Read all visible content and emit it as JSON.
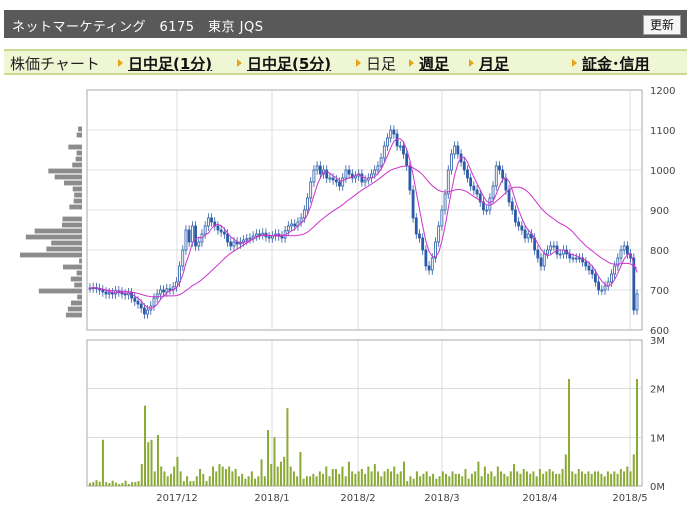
{
  "header": {
    "title": "ネットマーケティング　6175　東京 JQS",
    "refresh_label": "更新"
  },
  "tabs": [
    {
      "label": "株価チャート",
      "link": false,
      "arrow": false
    },
    {
      "label": "日中足(1分)",
      "link": true,
      "arrow": true
    },
    {
      "label": "日中足(5分)",
      "link": true,
      "arrow": true
    },
    {
      "label": "日足",
      "link": false,
      "arrow": true
    },
    {
      "label": "週足",
      "link": true,
      "arrow": true
    },
    {
      "label": "月足",
      "link": true,
      "arrow": true
    },
    {
      "label": "証金･信用",
      "link": true,
      "arrow": true
    }
  ],
  "chart_data": {
    "type": "candlestick",
    "price_axis": {
      "ticks": [
        600,
        700,
        800,
        900,
        1000,
        1100,
        1200
      ],
      "range": [
        600,
        1200
      ]
    },
    "volume_axis": {
      "ticks": [
        "0M",
        "1M",
        "2M",
        "3M"
      ],
      "range": [
        0,
        3000000
      ]
    },
    "x_tick_labels": [
      "2017/12",
      "2018/1",
      "2018/2",
      "2018/3",
      "2018/4",
      "2018/5"
    ],
    "colors": {
      "up": "#2a5aa8",
      "down": "#2a5aa8",
      "ma": "#cc33cc",
      "volume": "#8aaa36",
      "grid": "#c8c8c8",
      "profile": "#8c8c8c"
    },
    "closes": [
      705,
      706,
      704,
      700,
      695,
      690,
      693,
      690,
      698,
      695,
      690,
      688,
      693,
      680,
      672,
      665,
      655,
      640,
      650,
      660,
      680,
      690,
      700,
      695,
      703,
      700,
      708,
      720,
      760,
      800,
      850,
      820,
      860,
      810,
      820,
      840,
      860,
      880,
      870,
      860,
      850,
      845,
      840,
      820,
      810,
      820,
      815,
      820,
      825,
      828,
      830,
      835,
      840,
      838,
      842,
      833,
      830,
      835,
      840,
      835,
      830,
      848,
      860,
      865,
      860,
      870,
      880,
      900,
      930,
      970,
      1000,
      1010,
      990,
      1000,
      980,
      980,
      975,
      970,
      960,
      980,
      1000,
      990,
      980,
      985,
      990,
      970,
      975,
      980,
      990,
      1000,
      1010,
      1030,
      1060,
      1080,
      1100,
      1090,
      1060,
      1060,
      1040,
      1010,
      950,
      880,
      840,
      830,
      800,
      760,
      750,
      780,
      820,
      860,
      900,
      940,
      1000,
      1040,
      1060,
      1040,
      1020,
      1000,
      980,
      960,
      950,
      940,
      920,
      900,
      900,
      930,
      960,
      1010,
      1000,
      980,
      950,
      920,
      900,
      870,
      860,
      850,
      830,
      840,
      830,
      800,
      780,
      760,
      790,
      800,
      810,
      810,
      790,
      790,
      800,
      790,
      780,
      780,
      780,
      780,
      770,
      760,
      750,
      740,
      720,
      700,
      700,
      710,
      720,
      740,
      760,
      780,
      800,
      810,
      790,
      780,
      650,
      690
    ],
    "volume_values": [
      60000,
      80000,
      120000,
      90000,
      950000,
      80000,
      60000,
      110000,
      70000,
      40000,
      60000,
      110000,
      40000,
      80000,
      80000,
      100000,
      450000,
      1650000,
      900000,
      950000,
      300000,
      1050000,
      400000,
      300000,
      200000,
      250000,
      400000,
      600000,
      300000,
      100000,
      200000,
      100000,
      100000,
      200000,
      350000,
      250000,
      100000,
      200000,
      400000,
      300000,
      450000,
      400000,
      350000,
      400000,
      300000,
      350000,
      200000,
      250000,
      150000,
      200000,
      300000,
      150000,
      200000,
      550000,
      200000,
      1150000,
      450000,
      1000000,
      400000,
      500000,
      600000,
      1600000,
      400000,
      300000,
      200000,
      700000,
      150000,
      200000,
      200000,
      250000,
      200000,
      300000,
      250000,
      400000,
      200000,
      350000,
      350000,
      250000,
      400000,
      200000,
      500000,
      300000,
      250000,
      300000,
      350000,
      250000,
      400000,
      300000,
      450000,
      300000,
      200000,
      300000,
      350000,
      300000,
      400000,
      250000,
      300000,
      500000,
      100000,
      200000,
      150000,
      300000,
      200000,
      250000,
      300000,
      200000,
      250000,
      150000,
      200000,
      300000,
      250000,
      200000,
      300000,
      250000,
      250000,
      200000,
      350000,
      150000,
      250000,
      300000,
      500000,
      200000,
      400000,
      250000,
      300000,
      200000,
      400000,
      300000,
      250000,
      200000,
      300000,
      450000,
      300000,
      250000,
      350000,
      300000,
      250000,
      300000,
      200000,
      350000,
      250000,
      300000,
      350000,
      300000,
      250000,
      250000,
      350000,
      650000,
      2200000,
      300000,
      250000,
      350000,
      300000,
      250000,
      300000,
      250000,
      300000,
      300000,
      250000,
      200000,
      300000,
      250000,
      300000,
      250000,
      350000,
      300000,
      400000,
      300000,
      650000,
      2200000
    ]
  }
}
